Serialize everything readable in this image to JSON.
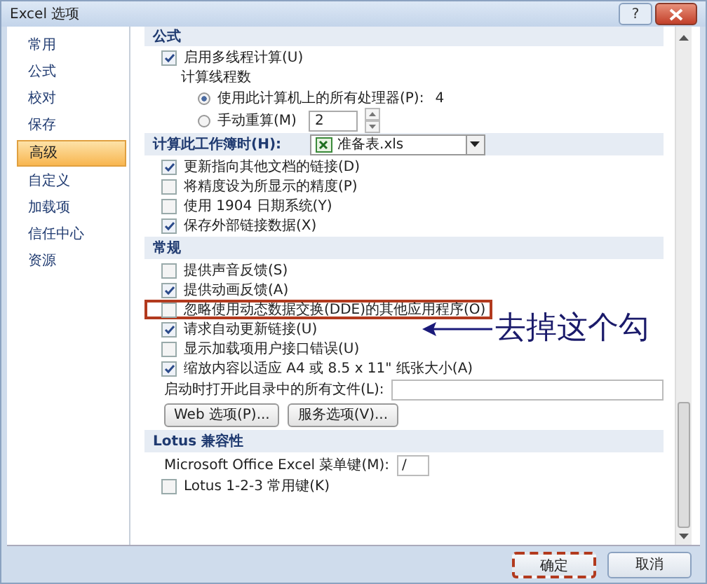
{
  "window": {
    "title": "Excel 选项",
    "help_button": "?"
  },
  "sidebar": {
    "items": [
      {
        "label": "常用",
        "selected": false
      },
      {
        "label": "公式",
        "selected": false
      },
      {
        "label": "校对",
        "selected": false
      },
      {
        "label": "保存",
        "selected": false
      },
      {
        "label": "高级",
        "selected": true
      },
      {
        "label": "自定义",
        "selected": false
      },
      {
        "label": "加载项",
        "selected": false
      },
      {
        "label": "信任中心",
        "selected": false
      },
      {
        "label": "资源",
        "selected": false
      }
    ]
  },
  "sections": [
    {
      "header": "公式",
      "rows": [
        {
          "kind": "checkbox",
          "label": "启用多线程计算(U)",
          "checked": true
        },
        {
          "kind": "subhead",
          "label": "计算线程数"
        },
        {
          "kind": "radio",
          "label": "使用此计算机上的所有处理器(P):",
          "value": "4",
          "selected": true
        },
        {
          "kind": "radio_spin",
          "label": "手动重算(M)",
          "value": "2",
          "selected": false
        }
      ]
    },
    {
      "header": "计算此工作簿时(H):",
      "dropdown": {
        "value": "准备表.xls"
      },
      "rows": [
        {
          "kind": "checkbox",
          "label": "更新指向其他文档的链接(D)",
          "checked": true
        },
        {
          "kind": "checkbox",
          "label": "将精度设为所显示的精度(P)",
          "checked": false
        },
        {
          "kind": "checkbox",
          "label": "使用 1904 日期系统(Y)",
          "checked": false
        },
        {
          "kind": "checkbox",
          "label": "保存外部链接数据(X)",
          "checked": true
        }
      ]
    },
    {
      "header": "常规",
      "rows": [
        {
          "kind": "checkbox",
          "label": "提供声音反馈(S)",
          "checked": false
        },
        {
          "kind": "checkbox",
          "label": "提供动画反馈(A)",
          "checked": true
        },
        {
          "kind": "checkbox",
          "label": "忽略使用动态数据交换(DDE)的其他应用程序(O)",
          "checked": false,
          "highlighted": true
        },
        {
          "kind": "checkbox",
          "label": "请求自动更新链接(U)",
          "checked": true
        },
        {
          "kind": "checkbox",
          "label": "显示加载项用户接口错误(U)",
          "checked": false
        },
        {
          "kind": "checkbox",
          "label": "缩放内容以适应 A4 或 8.5 x 11\" 纸张大小(A)",
          "checked": true
        },
        {
          "kind": "input",
          "label": "启动时打开此目录中的所有文件(L):"
        },
        {
          "kind": "buttons",
          "buttons": [
            "Web 选项(P)...",
            "服务选项(V)..."
          ]
        }
      ]
    },
    {
      "header": "Lotus 兼容性",
      "rows": [
        {
          "kind": "input_short",
          "label": "Microsoft Office Excel 菜单键(M):",
          "value": "/"
        },
        {
          "kind": "checkbox",
          "label": "Lotus 1-2-3 常用键(K)",
          "checked": false
        }
      ]
    }
  ],
  "callout": {
    "text": "去掉这个勾"
  },
  "footer": {
    "buttons": [
      {
        "label": "确定",
        "highlighted": true
      },
      {
        "label": "取消",
        "highlighted": false
      }
    ]
  }
}
